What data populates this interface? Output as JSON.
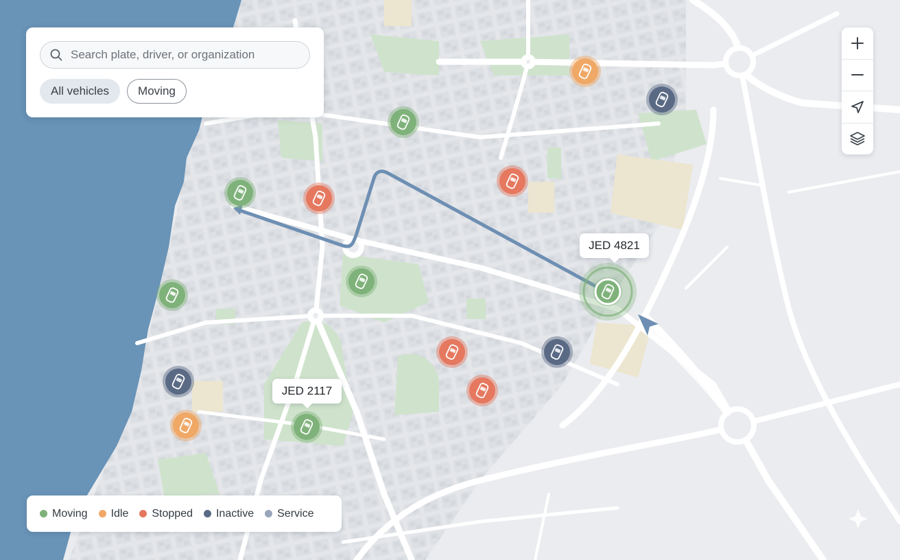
{
  "search": {
    "placeholder": "Search plate, driver, or organization",
    "value": ""
  },
  "filters": [
    {
      "label": "All vehicles",
      "active": true
    },
    {
      "label": "Moving",
      "active": false
    }
  ],
  "map_controls": [
    {
      "id": "zoom-in",
      "icon": "plus-icon"
    },
    {
      "id": "zoom-out",
      "icon": "minus-icon"
    },
    {
      "id": "locate",
      "icon": "navigation-arrow-icon"
    },
    {
      "id": "layers",
      "icon": "layers-icon"
    }
  ],
  "legend": [
    {
      "label": "Moving",
      "color": "#7fb27a"
    },
    {
      "label": "Idle",
      "color": "#f0a866"
    },
    {
      "label": "Stopped",
      "color": "#e5785f"
    },
    {
      "label": "Inactive",
      "color": "#5a6a85"
    },
    {
      "label": "Service",
      "color": "#9aa6bb"
    }
  ],
  "status_colors": {
    "moving": "#7fb27a",
    "idle": "#f0a866",
    "stopped": "#e5785f",
    "inactive": "#5a6a85"
  },
  "colors": {
    "water": "#6993b7",
    "park": "#cfe3cc",
    "sand": "#ece5cf",
    "route": "#6e8fb3"
  },
  "callouts": [
    {
      "label": "JED 4821"
    },
    {
      "label": "JED 2117"
    }
  ],
  "vehicles": [
    {
      "status": "moving"
    },
    {
      "status": "moving"
    },
    {
      "status": "moving"
    },
    {
      "status": "moving"
    },
    {
      "status": "moving",
      "plate": "JED 2117"
    },
    {
      "status": "moving",
      "plate": "JED 4821",
      "selected": true
    },
    {
      "status": "idle"
    },
    {
      "status": "idle"
    },
    {
      "status": "stopped"
    },
    {
      "status": "stopped"
    },
    {
      "status": "stopped"
    },
    {
      "status": "stopped"
    },
    {
      "status": "inactive"
    },
    {
      "status": "inactive"
    },
    {
      "status": "inactive"
    }
  ]
}
